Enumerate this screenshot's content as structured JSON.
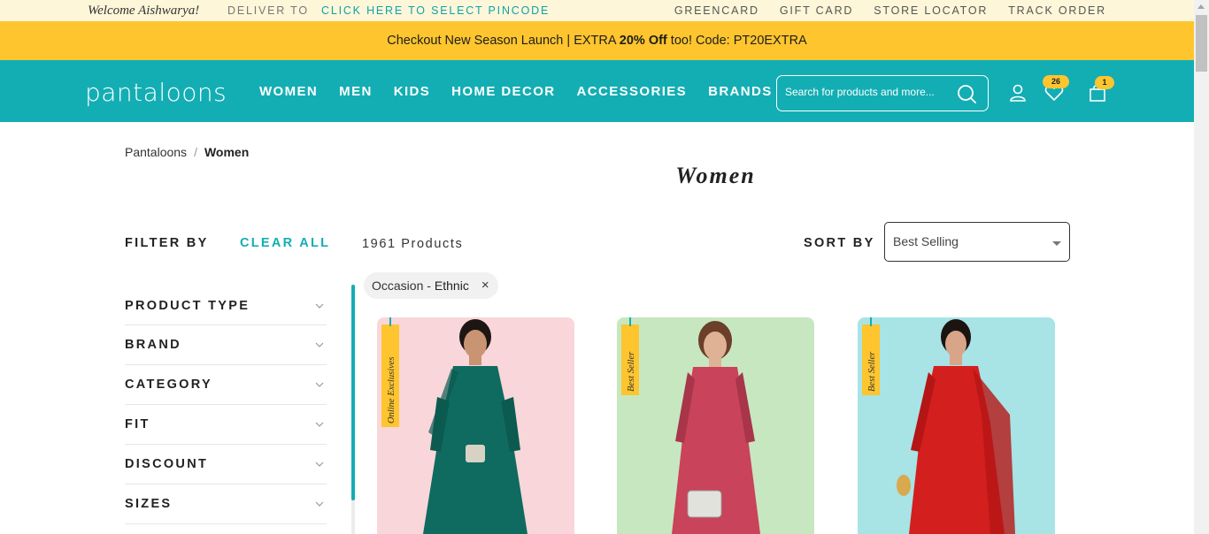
{
  "topbar": {
    "welcome": "Welcome Aishwarya!",
    "deliver_to": "DELIVER TO",
    "pincode_link": "CLICK HERE TO SELECT PINCODE",
    "links": [
      "GREENCARD",
      "GIFT CARD",
      "STORE LOCATOR",
      "TRACK ORDER"
    ]
  },
  "promo": {
    "prefix": "Checkout New Season Launch | EXTRA ",
    "highlight": "20% Off",
    "suffix": " too! Code: PT20EXTRA"
  },
  "header": {
    "logo": "pantaloons",
    "nav": [
      "WOMEN",
      "MEN",
      "KIDS",
      "HOME DECOR",
      "ACCESSORIES",
      "BRANDS"
    ],
    "search_placeholder": "Search for products and more...",
    "wishlist_count": "26",
    "cart_count": "1"
  },
  "breadcrumb": {
    "root": "Pantaloons",
    "separator": "/",
    "current": "Women"
  },
  "page_title": "Women",
  "toolbar": {
    "filter_by": "FILTER BY",
    "clear_all": "CLEAR ALL",
    "product_count": "1961 Products",
    "sort_by": "SORT BY",
    "sort_selected": "Best Selling"
  },
  "filters": [
    "PRODUCT TYPE",
    "BRAND",
    "CATEGORY",
    "FIT",
    "DISCOUNT",
    "SIZES"
  ],
  "active_chip": {
    "label": "Occasion - ",
    "value": "Ethnic",
    "close": "×"
  },
  "products": [
    {
      "tag": "Online Exclusives",
      "bg": "#f9d6d9",
      "garment": "#0f6b60",
      "accent": "#0c5a50"
    },
    {
      "tag": "Best Seller",
      "bg": "#c7e7c1",
      "garment": "#c9435a",
      "accent": "#a8354a"
    },
    {
      "tag": "Best Seller",
      "bg": "#a8e3e6",
      "garment": "#d41f1f",
      "accent": "#b51515"
    }
  ],
  "colors": {
    "teal": "#13aeb3",
    "yellow": "#fec52e",
    "cream": "#fdf6d9"
  }
}
